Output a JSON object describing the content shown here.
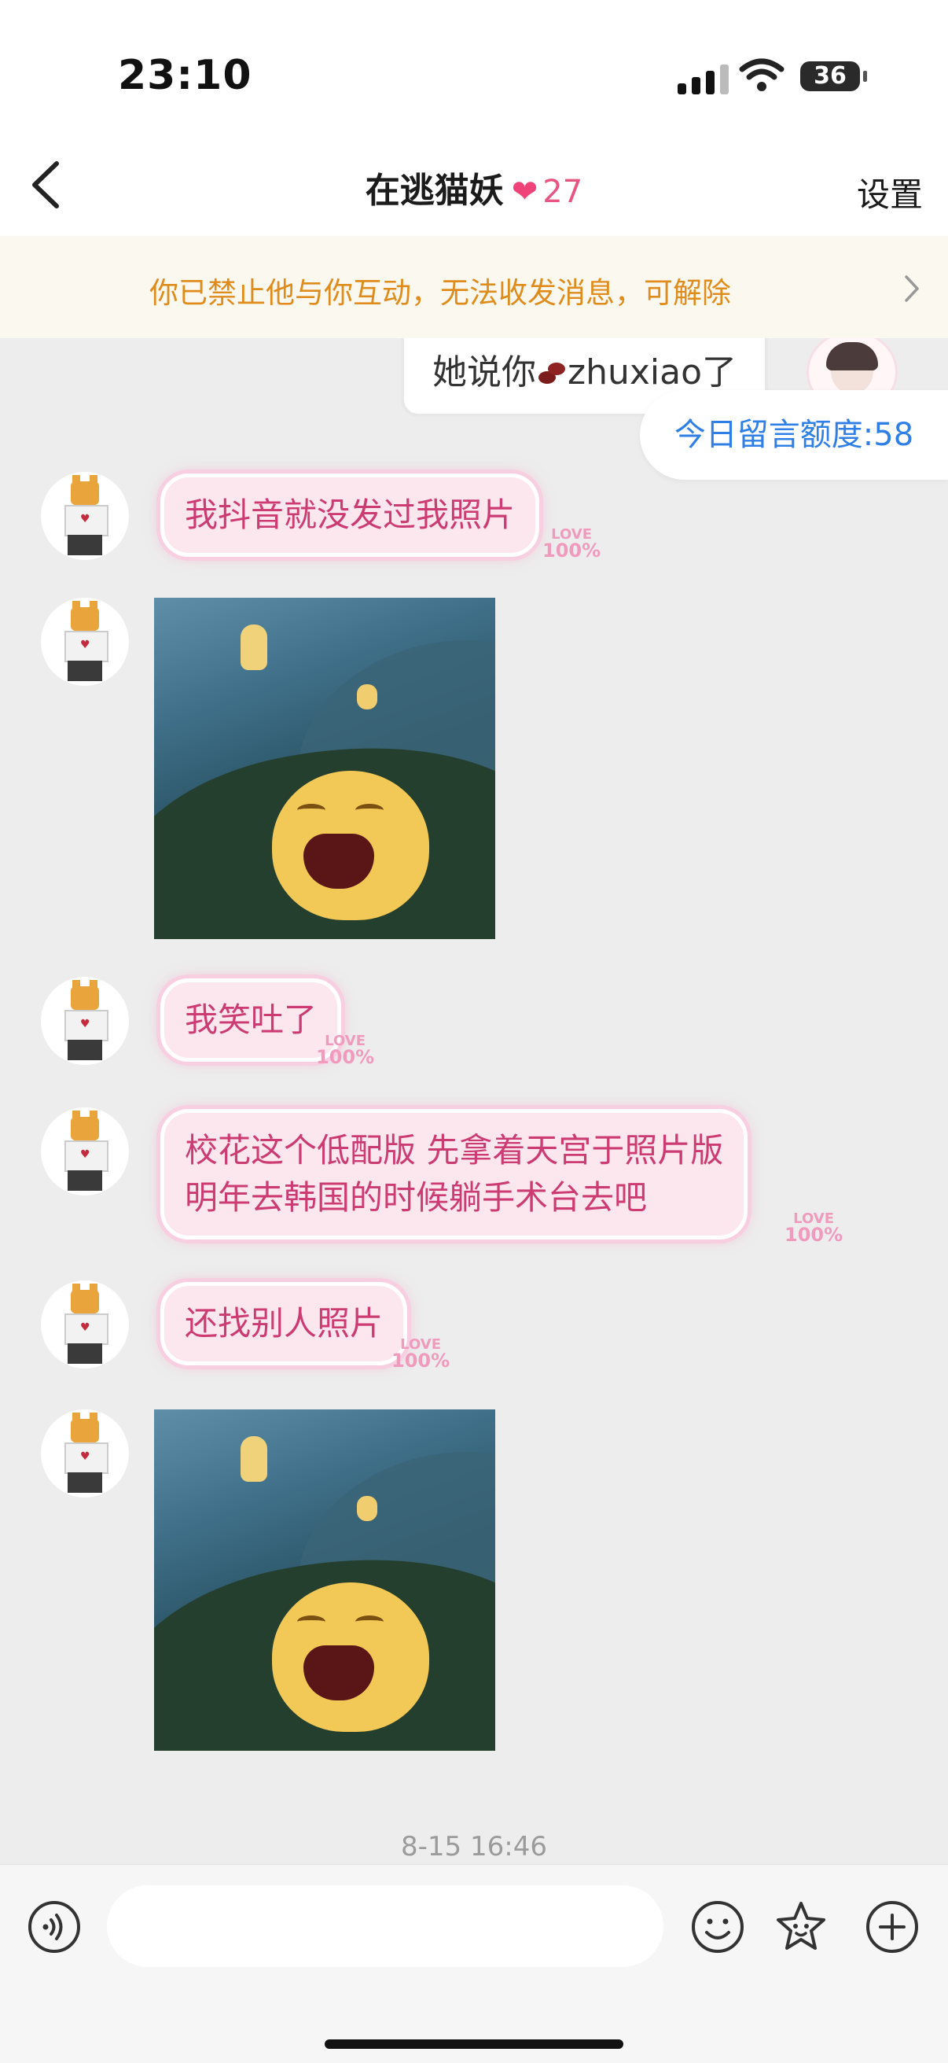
{
  "status_bar": {
    "time": "23:10",
    "battery": "36"
  },
  "nav": {
    "title": "在逃猫妖",
    "heart": "❤",
    "intimacy": "27",
    "settings": "设置"
  },
  "banner": {
    "text": "你已禁止他与你互动，无法收发消息，可解除"
  },
  "top_message": {
    "text_before": "她说你",
    "text_after": "zhuxiao了"
  },
  "quota": {
    "text": "今日留言额度:58"
  },
  "messages": [
    {
      "type": "text",
      "text": "我抖音就没发过我照片"
    },
    {
      "type": "image",
      "name": "laughing-blob-sticker"
    },
    {
      "type": "text",
      "text": "我笑吐了"
    },
    {
      "type": "text",
      "line1": "校花这个低配版 先拿着天宫于照片版",
      "line2": "明年去韩国的时候躺手术台去吧"
    },
    {
      "type": "text",
      "text": "还找别人照片"
    },
    {
      "type": "image",
      "name": "laughing-blob-sticker"
    }
  ],
  "love_badge": {
    "top": "LOVE",
    "value": "100%"
  },
  "avatar_shirt": "I ❤ CATS",
  "timestamp": "8-15 16:46",
  "colors": {
    "banner_text": "#e08c1c",
    "quota_text": "#2f7fe6",
    "bubble_text": "#cc3c72",
    "heart": "#f0437a"
  }
}
